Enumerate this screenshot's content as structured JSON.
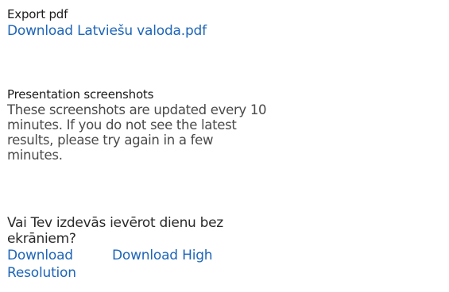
{
  "export": {
    "heading": "Export pdf",
    "link": "Download Latviešu valoda.pdf"
  },
  "screenshots": {
    "heading": "Presentation screenshots",
    "description": "These screenshots are updated every 10 minutes. If you do not see the latest results, please try again in a few minutes."
  },
  "question": {
    "text": "Vai Tev izdevās ievērot dienu bez ekrāniem?",
    "download_label": "Download Resolution",
    "download_high_label": "Download High"
  }
}
